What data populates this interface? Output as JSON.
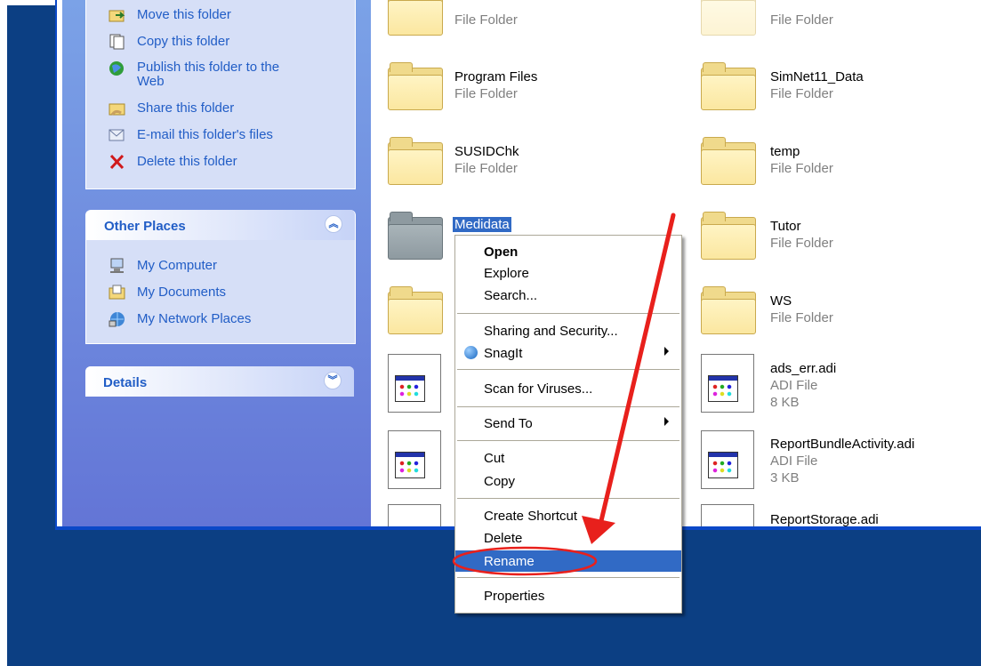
{
  "tasks": {
    "move": "Move this folder",
    "copy": "Copy this folder",
    "publish_line1": "Publish this folder to the",
    "publish_line2": "Web",
    "share": "Share this folder",
    "email": "E-mail this folder's files",
    "delete": "Delete this folder"
  },
  "other_places": {
    "title": "Other Places",
    "items": [
      "My Computer",
      "My Documents",
      "My Network Places"
    ]
  },
  "details": {
    "title": "Details"
  },
  "files": {
    "top_left_type": "File Folder",
    "top_right_type": "File Folder",
    "program_files": {
      "name": "Program Files",
      "type": "File Folder"
    },
    "simnet": {
      "name": "SimNet11_Data",
      "type": "File Folder"
    },
    "susidchk": {
      "name": "SUSIDChk",
      "type": "File Folder"
    },
    "temp": {
      "name": "temp",
      "type": "File Folder"
    },
    "medidata": {
      "name": "Medidata"
    },
    "tutor": {
      "name": "Tutor",
      "type": "File Folder"
    },
    "ws": {
      "name": "WS",
      "type": "File Folder"
    },
    "ads_err": {
      "name": "ads_err.adi",
      "type": "ADI File",
      "size": "8 KB"
    },
    "report_bundle": {
      "name": "ReportBundleActivity.adi",
      "type": "ADI File",
      "size": "3 KB"
    },
    "report_storage": {
      "name": "ReportStorage.adi"
    }
  },
  "context_menu": {
    "open": "Open",
    "explore": "Explore",
    "search": "Search...",
    "sharing": "Sharing and Security...",
    "snagit": "SnagIt",
    "scan": "Scan for Viruses...",
    "send_to": "Send To",
    "cut": "Cut",
    "copy": "Copy",
    "create_shortcut": "Create Shortcut",
    "delete": "Delete",
    "rename": "Rename",
    "properties": "Properties"
  },
  "colors": {
    "desktop": "#0c3f83",
    "highlight": "#316ac5",
    "annotation": "#e8201c"
  }
}
